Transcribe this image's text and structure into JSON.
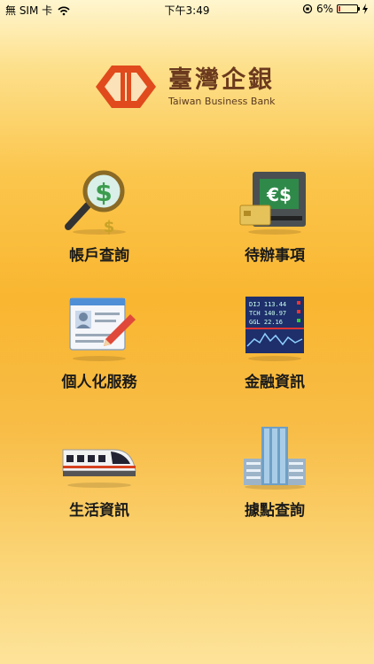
{
  "status_bar": {
    "carrier": "無 SIM 卡",
    "time": "下午3:49",
    "battery": "6%",
    "battery_level": 0.06
  },
  "brand": {
    "name_cn": "臺灣企銀",
    "name_en": "Taiwan Business Bank",
    "color_primary": "#e04a1c",
    "color_text": "#6b3a1e"
  },
  "menu": [
    {
      "label": "帳戶查詢",
      "icon": "magnifier-dollar-icon"
    },
    {
      "label": "待辦事項",
      "icon": "atm-card-icon"
    },
    {
      "label": "個人化服務",
      "icon": "profile-card-pencil-icon"
    },
    {
      "label": "金融資訊",
      "icon": "stock-ticker-icon"
    },
    {
      "label": "生活資訊",
      "icon": "high-speed-train-icon"
    },
    {
      "label": "據點查詢",
      "icon": "office-building-icon"
    }
  ]
}
